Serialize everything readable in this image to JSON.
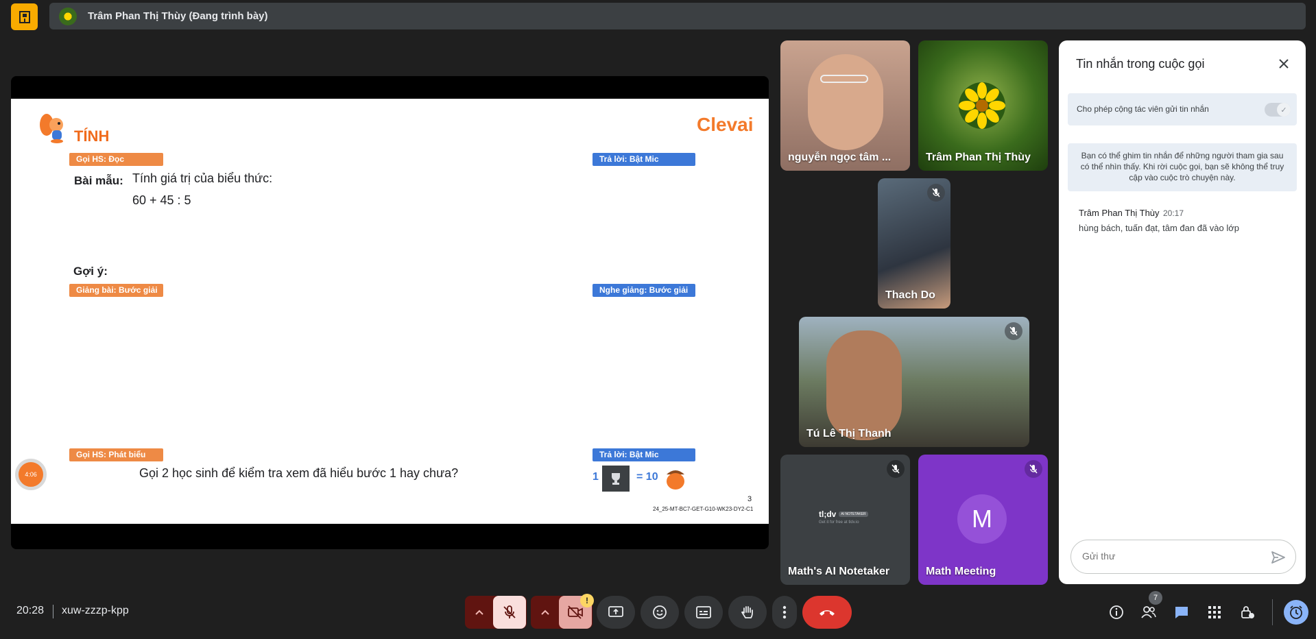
{
  "topbar": {
    "presenter_name": "Trâm Phan Thị Thùy (Đang trình bày)"
  },
  "slide": {
    "section_title": "TÍNH",
    "brand": "Clevai",
    "tag_goi_doc": "Gọi HS: Đọc",
    "tag_tra_loi_1": "Trả lời: Bật Mic",
    "bai_mau_label": "Bài mẫu:",
    "bai_mau_text": "Tính giá trị của biểu thức:",
    "expression": "60 + 45 : 5",
    "goi_y_label": "Gợi ý:",
    "tag_giang_bai": "Giảng bài: Bước giải",
    "tag_nghe_giang": "Nghe giảng: Bước giải",
    "tag_goi_phat_bieu": "Gọi HS: Phát biểu",
    "tag_tra_loi_2": "Trả lời: Bật Mic",
    "question": "Gọi 2 học sinh để kiểm tra xem đã hiểu bước 1 hay chưa?",
    "reward_left": "1",
    "reward_right": "= 10",
    "page_number": "3",
    "slide_code": "24_25-MT-BC7-GET-G10-WK23-DY2-C1",
    "timer": "4:06"
  },
  "participants": [
    {
      "name": "nguyễn ngọc tâm ..."
    },
    {
      "name": "Trâm Phan Thị Thùy"
    },
    {
      "name": "Thach Do"
    },
    {
      "name": "Tú Lê Thị Thanh"
    },
    {
      "name": "Math's AI Notetaker",
      "logo": "tl;dv",
      "logo_sub": "AI NOTETAKER",
      "tagline": "Get it for free at tldv.io"
    },
    {
      "name": "Math Meeting",
      "initial": "M"
    }
  ],
  "chat": {
    "title": "Tin nhắn trong cuộc gọi",
    "allow_label": "Cho phép cộng tác viên gửi tin nhắn",
    "pin_info": "Bạn có thể ghim tin nhắn để những người tham gia sau có thể nhìn thấy. Khi rời cuộc gọi, bạn sẽ không thể truy cập vào cuộc trò chuyện này.",
    "message": {
      "sender": "Trâm Phan Thị Thùy",
      "time": "20:17",
      "text": "hùng bách, tuấn đạt, tâm đan đã vào lớp"
    },
    "input_placeholder": "Gửi thư"
  },
  "bottombar": {
    "time": "20:28",
    "meeting_code": "xuw-zzzp-kpp",
    "people_count": "7",
    "camera_warning": "!"
  },
  "colors": {
    "accent_blue": "#8ab4f8",
    "end_call_red": "#dc362e",
    "presenter_yellow": "#f9ab00"
  }
}
